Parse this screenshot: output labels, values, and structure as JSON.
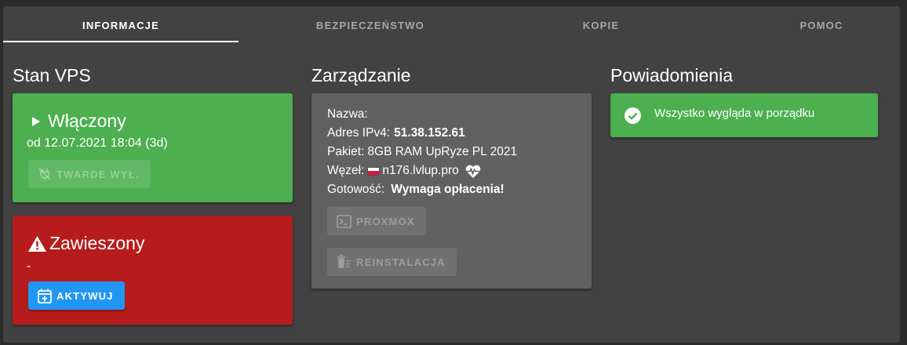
{
  "tabs": [
    {
      "label": "INFORMACJE",
      "active": true
    },
    {
      "label": "BEZPIECZEŃSTWO",
      "active": false
    },
    {
      "label": "KOPIE",
      "active": false
    },
    {
      "label": "POMOC",
      "active": false
    }
  ],
  "stan_vps": {
    "title": "Stan VPS",
    "power": {
      "status": "Włączony",
      "since": "od 12.07.2021 18:04 (3d)",
      "button_label": "TWARDE WYŁ.",
      "color": "#4caf50"
    },
    "suspension": {
      "status": "Zawieszony",
      "detail": "-",
      "button_label": "AKTYWUJ",
      "color": "#b71c1c"
    }
  },
  "zarzadzanie": {
    "title": "Zarządzanie",
    "nazwa_label": "Nazwa:",
    "ipv4_label": "Adres IPv4:",
    "ipv4_value": "51.38.152.61",
    "pakiet_label": "Pakiet:",
    "pakiet_value": "8GB RAM UpRyze PL 2021",
    "wezel_label": "Węzeł:",
    "wezel_value": "n176.lvlup.pro",
    "gotowosc_label": "Gotowość:",
    "gotowosc_value": "Wymaga opłacenia!",
    "proxmox_label": "PROXMOX",
    "reinstall_label": "REINSTALACJA"
  },
  "powiadomienia": {
    "title": "Powiadomienia",
    "message": "Wszystko wygląda w porządku",
    "color": "#4caf50"
  },
  "icons": [
    "play-icon",
    "power-off-icon",
    "warning-icon",
    "calendar-plus-icon",
    "poland-flag-icon",
    "heartbeat-icon",
    "console-icon",
    "trash-icon",
    "check-circle-icon"
  ]
}
